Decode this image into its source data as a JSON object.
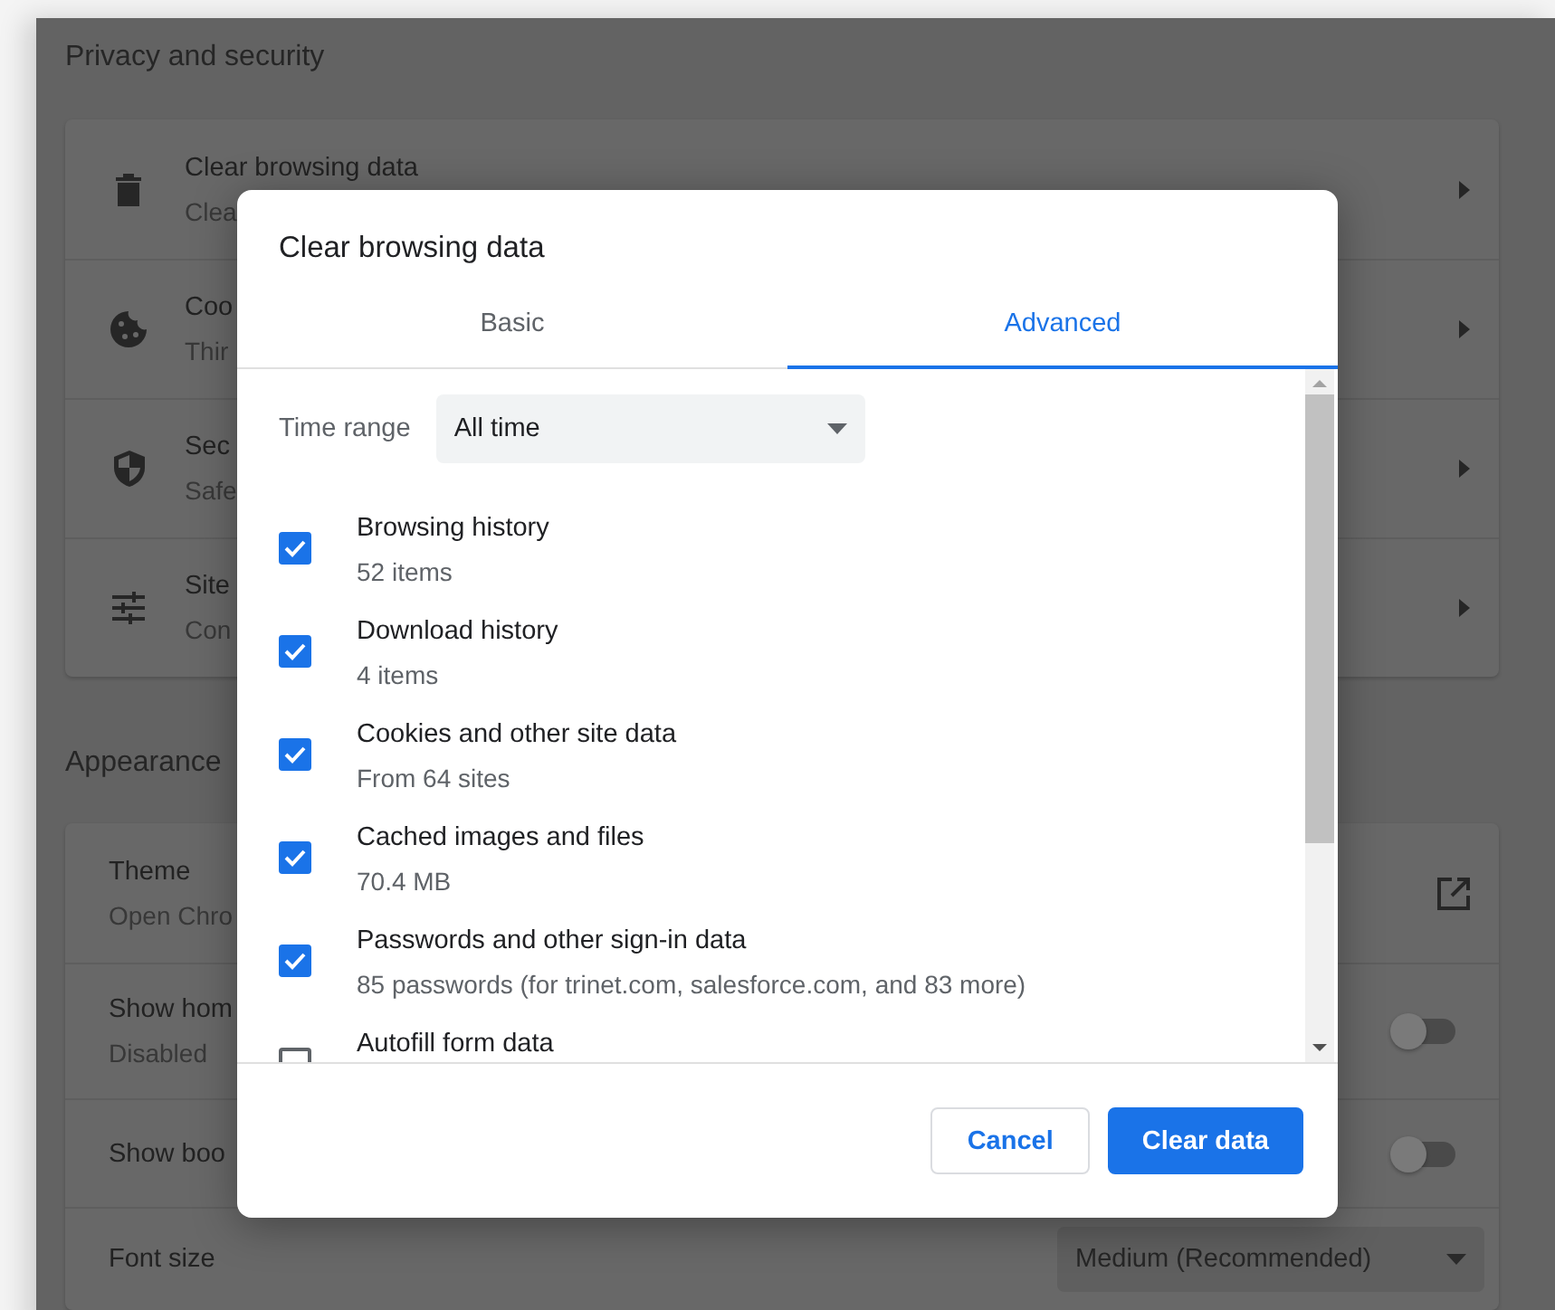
{
  "settings_page": {
    "sections": [
      {
        "heading": "Privacy and security",
        "rows": [
          {
            "kind": "link",
            "title": "Clear browsing data",
            "subtitle": "Clea"
          },
          {
            "kind": "link",
            "title": "Coo",
            "subtitle": "Thir"
          },
          {
            "kind": "link",
            "title": "Sec",
            "subtitle": "Safe"
          },
          {
            "kind": "link",
            "title": "Site",
            "subtitle": "Con"
          }
        ]
      },
      {
        "heading": "Appearance",
        "rows": [
          {
            "kind": "external",
            "title": "Theme",
            "subtitle": "Open Chro"
          },
          {
            "kind": "toggle",
            "title": "Show hom",
            "subtitle": "Disabled",
            "on": false
          },
          {
            "kind": "toggle",
            "title": "Show boo",
            "on": false
          },
          {
            "kind": "select",
            "title": "Font size",
            "value": "Medium (Recommended)"
          }
        ]
      }
    ]
  },
  "dialog": {
    "title": "Clear browsing data",
    "tabs": [
      {
        "label": "Basic",
        "selected": false
      },
      {
        "label": "Advanced",
        "selected": true
      }
    ],
    "time_range": {
      "label": "Time range",
      "value": "All time"
    },
    "items": [
      {
        "title": "Browsing history",
        "subtitle": "52 items",
        "checked": true
      },
      {
        "title": "Download history",
        "subtitle": "4 items",
        "checked": true
      },
      {
        "title": "Cookies and other site data",
        "subtitle": "From 64 sites",
        "checked": true
      },
      {
        "title": "Cached images and files",
        "subtitle": "70.4 MB",
        "checked": true
      },
      {
        "title": "Passwords and other sign-in data",
        "subtitle": "85 passwords (for trinet.com, salesforce.com, and 83 more)",
        "checked": true
      },
      {
        "title": "Autofill form data",
        "checked": false
      }
    ],
    "buttons": {
      "cancel": "Cancel",
      "confirm": "Clear data"
    }
  }
}
